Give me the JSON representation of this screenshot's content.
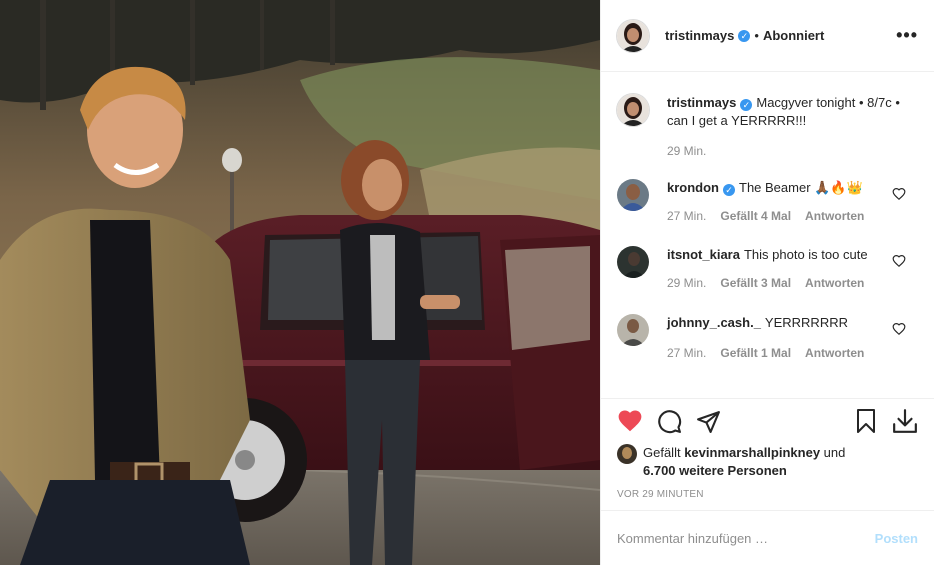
{
  "post": {
    "author": "tristinmays",
    "follow_status": "Abonniert",
    "more_label": "•••",
    "caption": "Macgyver tonight • 8/7c • can I get a YERRRRR!!!",
    "caption_time": "29 Min."
  },
  "comments": [
    {
      "user": "krondon",
      "verified": true,
      "text": "The Beamer 🙏🏾🔥👑",
      "time": "27 Min.",
      "likes": "Gefällt 4 Mal",
      "reply": "Antworten"
    },
    {
      "user": "itsnot_kiara",
      "verified": false,
      "text": "This photo is too cute",
      "time": "29 Min.",
      "likes": "Gefällt 3 Mal",
      "reply": "Antworten"
    },
    {
      "user": "johnny_.cash._",
      "verified": false,
      "text": "YERRRRRRR",
      "time": "27 Min.",
      "likes": "Gefällt 1 Mal",
      "reply": "Antworten"
    }
  ],
  "likes": {
    "prefix": "Gefällt",
    "user": "kevinmarshallpinkney",
    "joiner": "und",
    "others": "6.700 weitere Personen"
  },
  "posted_ago": "VOR 29 MINUTEN",
  "comment_box": {
    "placeholder": "Kommentar hinzufügen …",
    "post_label": "Posten"
  },
  "icons": {
    "like": "heart-filled-icon",
    "comment": "comment-bubble-icon",
    "share": "paper-plane-icon",
    "save": "bookmark-icon",
    "download": "download-icon"
  },
  "colors": {
    "like_red": "#ed4956",
    "verified_blue": "#3897f0",
    "post_button": "#b2dffc",
    "meta_gray": "#8e8e8e"
  }
}
